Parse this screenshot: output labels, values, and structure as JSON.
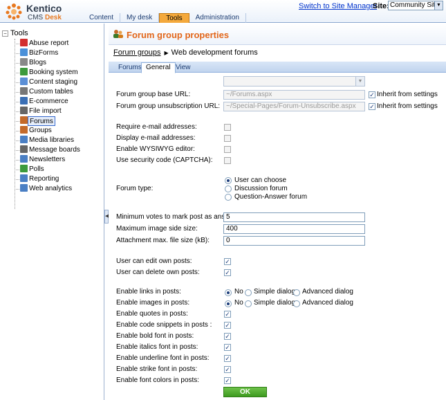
{
  "header": {
    "brand": "Kentico",
    "product_prefix": "CMS",
    "product_suffix": "Desk",
    "switch_link": "Switch to Site Manager",
    "site_label": "Site:",
    "site_value": "Community Site",
    "tabs": [
      "Content",
      "My desk",
      "Tools",
      "Administration"
    ],
    "active_tab": "Tools"
  },
  "tree": {
    "root": "Tools",
    "items": [
      {
        "label": "Abuse report",
        "icon": "abuse-report-icon",
        "color": "#d32f2f"
      },
      {
        "label": "BizForms",
        "icon": "bizforms-icon",
        "color": "#4a90d9"
      },
      {
        "label": "Blogs",
        "icon": "blogs-icon",
        "color": "#888888"
      },
      {
        "label": "Booking system",
        "icon": "booking-system-icon",
        "color": "#3c9a3c"
      },
      {
        "label": "Content staging",
        "icon": "content-staging-icon",
        "color": "#5b8fd6"
      },
      {
        "label": "Custom tables",
        "icon": "custom-tables-icon",
        "color": "#777777"
      },
      {
        "label": "E-commerce",
        "icon": "ecommerce-icon",
        "color": "#3a6fb5"
      },
      {
        "label": "File import",
        "icon": "file-import-icon",
        "color": "#666666"
      },
      {
        "label": "Forums",
        "icon": "forums-icon",
        "color": "#c46a2a"
      },
      {
        "label": "Groups",
        "icon": "groups-icon",
        "color": "#c46a2a"
      },
      {
        "label": "Media libraries",
        "icon": "media-libraries-icon",
        "color": "#4a7fc4"
      },
      {
        "label": "Message boards",
        "icon": "message-boards-icon",
        "color": "#666666"
      },
      {
        "label": "Newsletters",
        "icon": "newsletters-icon",
        "color": "#4a7fc4"
      },
      {
        "label": "Polls",
        "icon": "polls-icon",
        "color": "#3c9a3c"
      },
      {
        "label": "Reporting",
        "icon": "reporting-icon",
        "color": "#4a7fc4"
      },
      {
        "label": "Web analytics",
        "icon": "web-analytics-icon",
        "color": "#4a7fc4"
      }
    ],
    "selected": "Forums"
  },
  "page": {
    "title": "Forum group properties",
    "breadcrumb_link": "Forum groups",
    "breadcrumb_current": "Web development forums",
    "subtabs": [
      "Forums",
      "General",
      "View"
    ],
    "active_subtab": "General"
  },
  "form": {
    "base_url_label": "Forum group base URL:",
    "base_url_value": "~/Forums.aspx",
    "unsub_url_label": "Forum group unsubscription URL:",
    "unsub_url_value": "~/Special-Pages/Forum-Unsubscribe.aspx",
    "inherit_label": "Inherit from settings",
    "require_email_label": "Require e-mail addresses:",
    "display_email_label": "Display e-mail addresses:",
    "wysiwyg_label": "Enable WYSIWYG editor:",
    "captcha_label": "Use security code (CAPTCHA):",
    "forum_type_label": "Forum type:",
    "forum_type_options": [
      "User can choose",
      "Discussion forum",
      "Question-Answer forum"
    ],
    "forum_type_selected": "User can choose",
    "min_votes_label": "Minimum votes to mark post as answer:",
    "min_votes_value": "5",
    "max_image_label": "Maximum image side size:",
    "max_image_value": "400",
    "attach_label": "Attachment max. file size (kB):",
    "attach_value": "0",
    "edit_posts_label": "User can edit own posts:",
    "delete_posts_label": "User can delete own posts:",
    "links_label": "Enable links in posts:",
    "images_label": "Enable images in posts:",
    "dialog_options": [
      "No",
      "Simple dialog",
      "Advanced dialog"
    ],
    "quotes_label": "Enable quotes in posts:",
    "code_label": "Enable code snippets in posts :",
    "bold_label": "Enable bold font in posts:",
    "italics_label": "Enable italics font in posts:",
    "underline_label": "Enable underline font in posts:",
    "strike_label": "Enable strike font in posts:",
    "colors_label": "Enable font colors in posts:",
    "ok_label": "OK"
  }
}
